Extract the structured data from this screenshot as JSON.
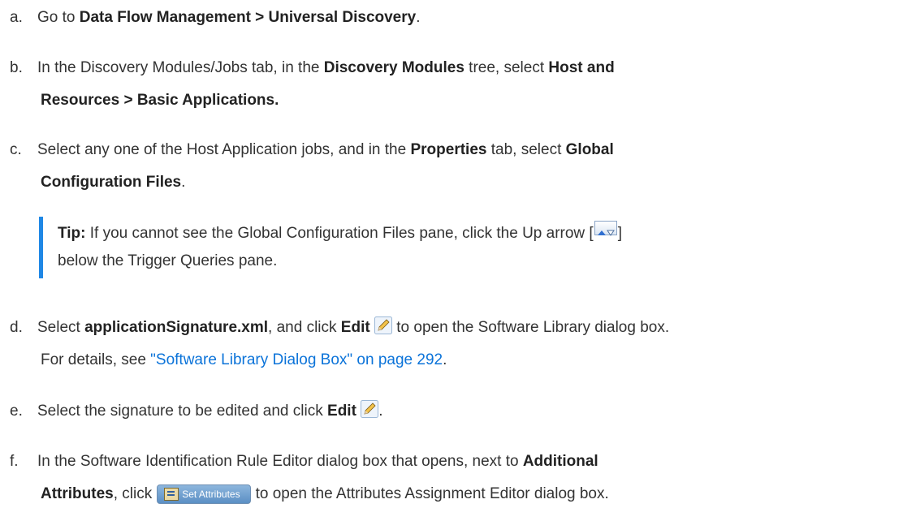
{
  "steps": {
    "a": {
      "marker": "a.",
      "text1": "Go to ",
      "bold1": "Data Flow Management > Universal Discovery",
      "text2": "."
    },
    "b": {
      "marker": "b.",
      "text1": "In the Discovery Modules/Jobs tab, in the ",
      "bold1": "Discovery Modules",
      "text2": " tree, select ",
      "bold2": "Host and",
      "bold3": "Resources > Basic Applications."
    },
    "c": {
      "marker": "c.",
      "text1": "Select any one of the Host Application jobs, and in the ",
      "bold1": "Properties",
      "text2": " tab, select ",
      "bold2": "Global",
      "bold3": "Configuration Files",
      "text3": "."
    },
    "tip": {
      "label": "Tip:",
      "text1": " If you cannot see the Global Configuration Files pane, click the Up arrow [",
      "text2": "]",
      "text3": "below the Trigger Queries pane."
    },
    "d": {
      "marker": "d.",
      "text1": "Select ",
      "bold1": "applicationSignature.xml",
      "text2": ", and click ",
      "bold2": "Edit",
      "text3": " to open the Software Library dialog box.",
      "text4": "For details, see ",
      "link": "\"Software Library Dialog Box\" on page 292",
      "text5": "."
    },
    "e": {
      "marker": "e.",
      "text1": "Select the signature to be edited and click ",
      "bold1": "Edit",
      "text2": "."
    },
    "f": {
      "marker": "f.",
      "text1": "In the Software Identification Rule Editor dialog box that opens, next to ",
      "bold1": "Additional",
      "bold2": "Attributes",
      "text2": ", click",
      "button_label": "Set Attributes",
      "text3": "to open the Attributes Assignment Editor dialog box."
    }
  },
  "icons": {
    "edit": "pencil-icon",
    "updown": "up-down-arrow-icon",
    "set_attributes": "properties-icon"
  },
  "colors": {
    "text": "#333333",
    "link": "#0b73d9",
    "tip_bar": "#1f87e5"
  }
}
